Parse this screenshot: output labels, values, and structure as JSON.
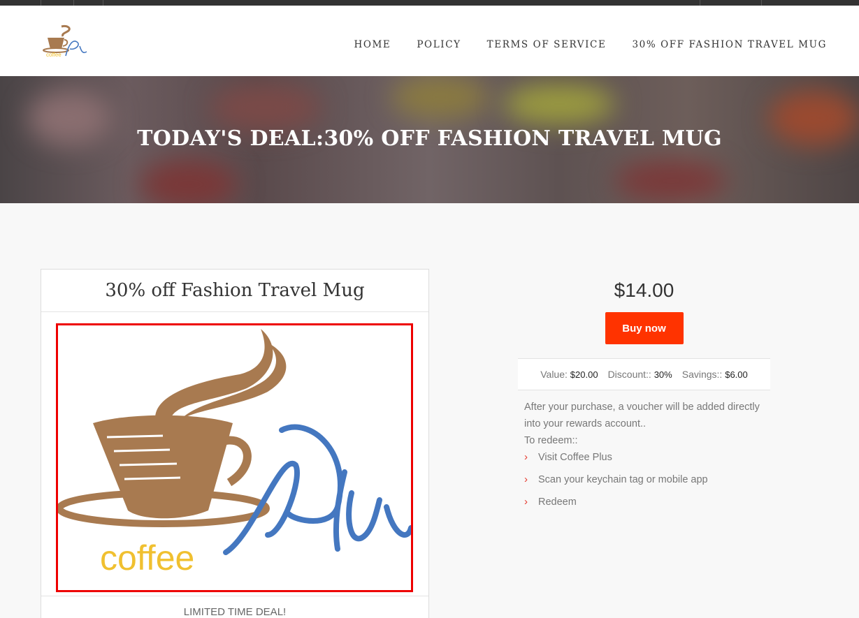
{
  "nav": {
    "items": [
      "HOME",
      "POLICY",
      "TERMS OF SERVICE",
      "30% OFF FASHION TRAVEL MUG"
    ]
  },
  "hero": {
    "title": "TODAY'S DEAL:30% OFF FASHION TRAVEL MUG"
  },
  "deal": {
    "title": "30% off Fashion Travel Mug",
    "footer": "LIMITED TIME DEAL!",
    "image_label": "coffee"
  },
  "purchase": {
    "price": "$14.00",
    "buy_label": "Buy now",
    "value_label": "Value:",
    "value": "$20.00",
    "discount_label": "Discount::",
    "discount": "30%",
    "savings_label": "Savings::",
    "savings": "$6.00",
    "description": "After your purchase, a voucher will be added directly into your rewards account..",
    "redeem_heading": "To redeem::",
    "steps": [
      "Visit Coffee Plus",
      "Scan your keychain tag or mobile app",
      "Redeem"
    ]
  },
  "colors": {
    "accent": "#ff3300",
    "coffee_brown": "#a87a50",
    "plus_blue": "#4477c0",
    "coffee_yellow": "#f0c030",
    "highlight_border": "#ee0000"
  },
  "icons": {
    "logo": "coffee-cup-logo-icon",
    "list_bullet": "chevron-right-icon"
  }
}
